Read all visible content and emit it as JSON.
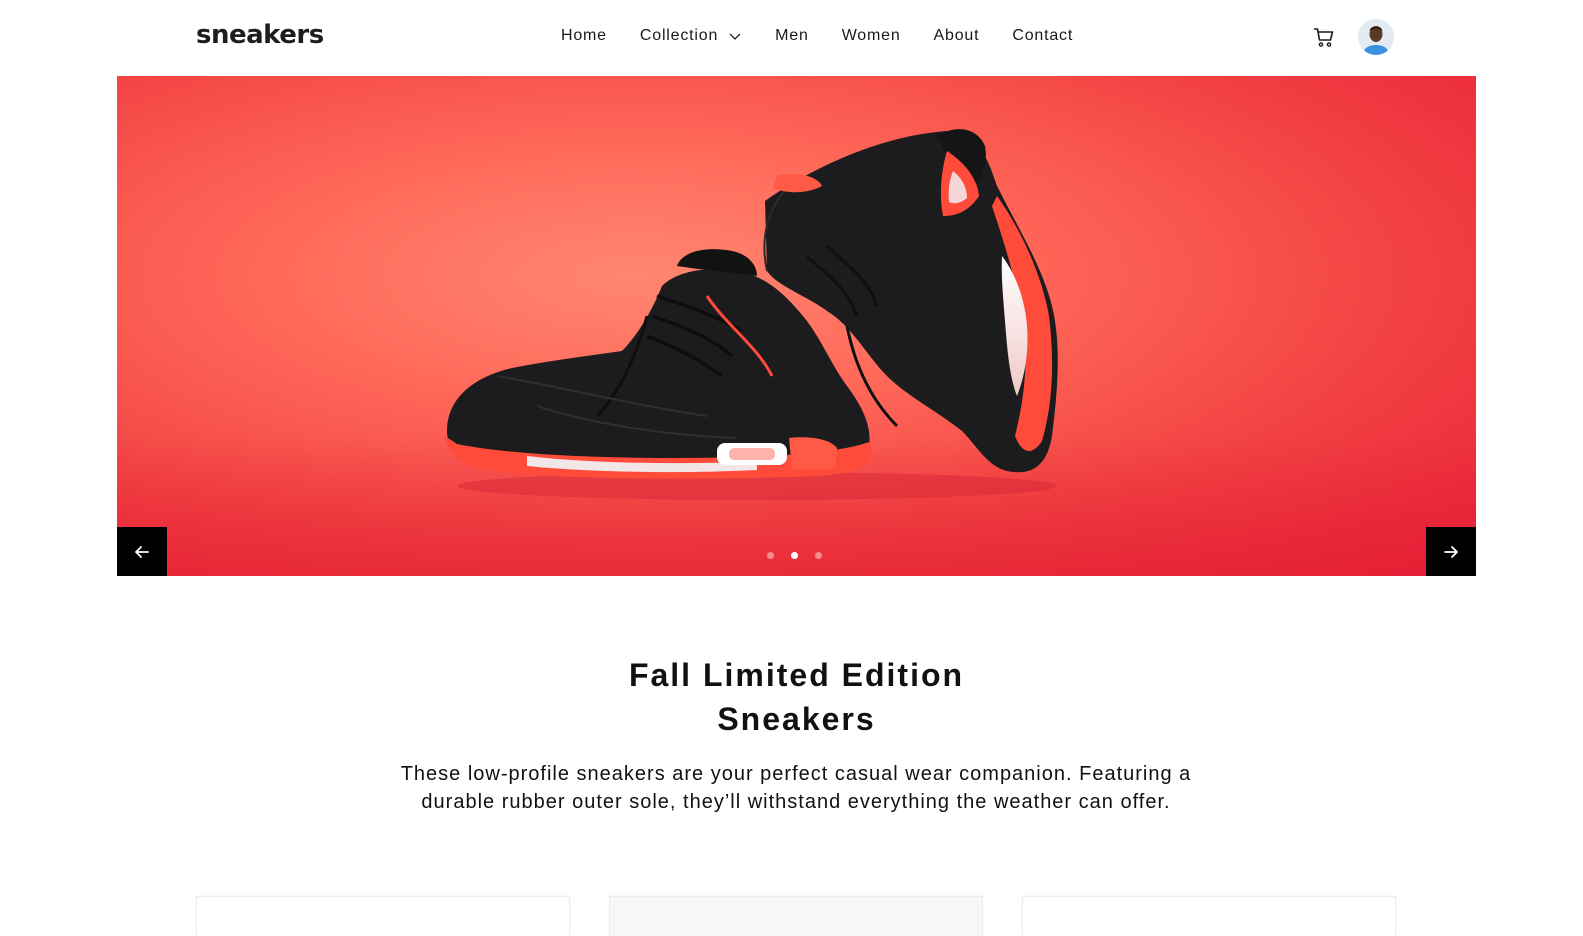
{
  "brand": {
    "logo_text": "sneakers"
  },
  "nav": {
    "items": [
      {
        "label": "Home"
      },
      {
        "label": "Collection"
      },
      {
        "label": "Men"
      },
      {
        "label": "Women"
      },
      {
        "label": "About"
      },
      {
        "label": "Contact"
      }
    ]
  },
  "icons": {
    "cart": "cart-icon",
    "collection_dropdown": "chevron-down-icon",
    "prev": "arrow-left-icon",
    "next": "arrow-right-icon"
  },
  "hero": {
    "slide_count": 3,
    "active_slide": 2,
    "colors": {
      "background": "#f24242",
      "shoe": "#1b1b1d",
      "accent": "#ff4b3a"
    }
  },
  "intro": {
    "title_line1": "Fall Limited Edition",
    "title_line2": "Sneakers",
    "description": "These low-profile sneakers are your perfect casual wear companion. Featuring a durable rubber outer sole, they’ll withstand everything the weather can offer."
  }
}
